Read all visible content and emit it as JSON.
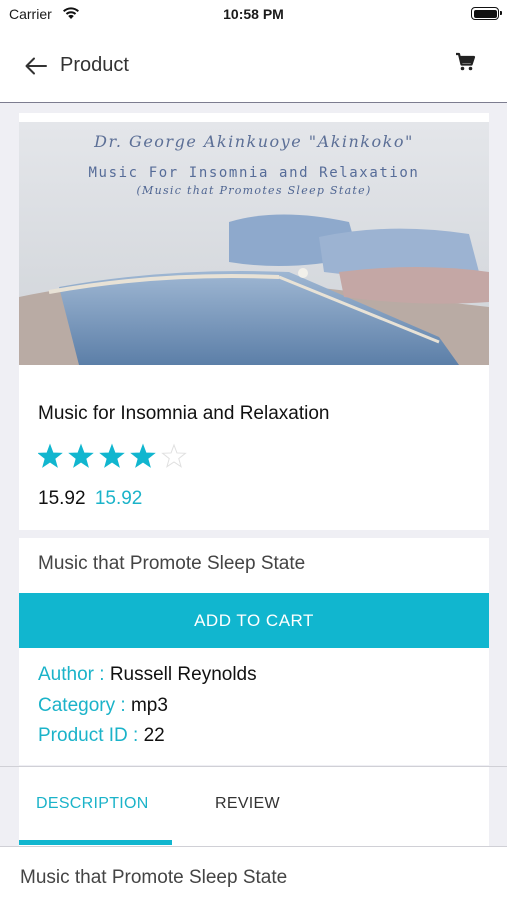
{
  "status_bar": {
    "carrier": "Carrier",
    "time": "10:58 PM"
  },
  "nav": {
    "title": "Product",
    "back_icon": "arrow-left-icon",
    "cart_icon": "cart-icon"
  },
  "hero": {
    "author_text": "Dr. George Akinkuoye \"Akinkoko\"",
    "title_text": "Music For Insomnia and Relaxation",
    "subtitle_text": "(Music that Promotes Sleep State)"
  },
  "product": {
    "name": "Music for Insomnia and Relaxation",
    "rating": 4,
    "rating_max": 5,
    "price": "15.92",
    "sale_price": "15.92",
    "short_description": "Music that Promote Sleep State"
  },
  "add_to_cart_label": "ADD TO CART",
  "meta": [
    {
      "label": "Author :",
      "value": "Russell Reynolds"
    },
    {
      "label": "Category :",
      "value": "mp3"
    },
    {
      "label": "Product ID :",
      "value": "22"
    }
  ],
  "tabs": [
    {
      "label": "DESCRIPTION",
      "active": true
    },
    {
      "label": "REVIEW",
      "active": false
    }
  ],
  "description": "Music that Promote Sleep State",
  "colors": {
    "accent": "#11b6cf",
    "background": "#efeff4",
    "text": "#111111"
  }
}
